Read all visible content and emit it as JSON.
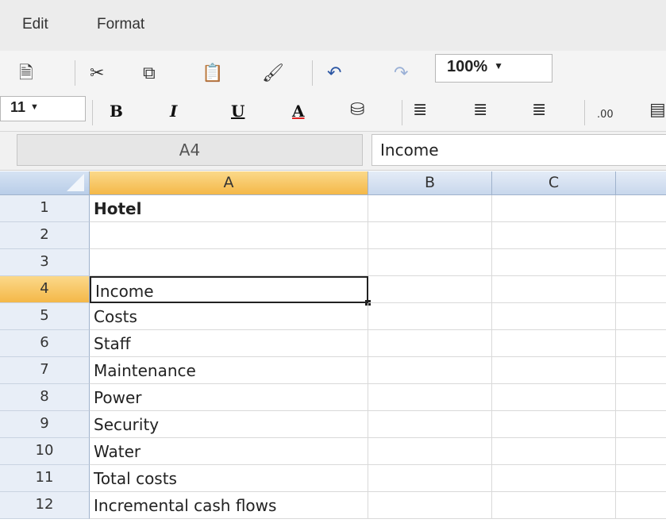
{
  "menu": {
    "edit": "Edit",
    "format": "Format"
  },
  "toolbar": {
    "zoom": "100%",
    "zoom_caret": "▼",
    "font_size": "11",
    "font_size_caret": "▼",
    "bold": "B",
    "italic": "I",
    "underline": "U",
    "font_color": "A",
    "decimal": ".00"
  },
  "formula_bar": {
    "cell_ref": "A4",
    "value": "Income"
  },
  "columns": [
    "A",
    "B",
    "C"
  ],
  "rows": [
    {
      "num": "1",
      "a": "Hotel"
    },
    {
      "num": "2",
      "a": ""
    },
    {
      "num": "3",
      "a": ""
    },
    {
      "num": "4",
      "a": "Income"
    },
    {
      "num": "5",
      "a": "Costs"
    },
    {
      "num": "6",
      "a": "Staff"
    },
    {
      "num": "7",
      "a": "Maintenance"
    },
    {
      "num": "8",
      "a": "Power"
    },
    {
      "num": "9",
      "a": "Security"
    },
    {
      "num": "10",
      "a": "Water"
    },
    {
      "num": "11",
      "a": "Total costs"
    },
    {
      "num": "12",
      "a": "Incremental cash flows"
    }
  ],
  "selection": {
    "column": "A",
    "row": "4"
  },
  "colors": {
    "selection_header": "#f4b848",
    "header_blue": "#c8d7ec"
  }
}
